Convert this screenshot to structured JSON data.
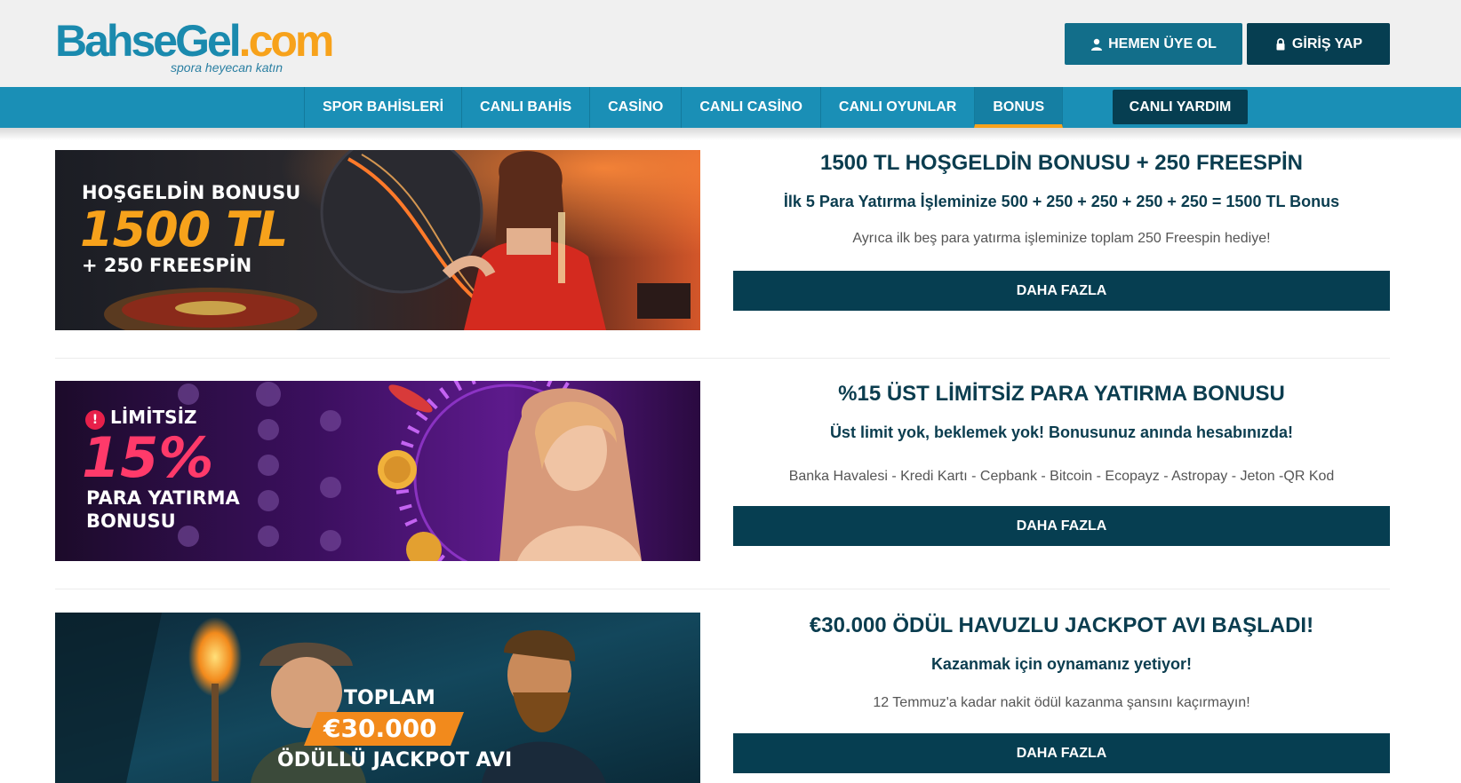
{
  "header": {
    "logo_brand": "BahseGel",
    "logo_tld": ".com",
    "logo_tagline": "spora heyecan katın",
    "register_label": "HEMEN ÜYE OL",
    "login_label": "GİRİŞ YAP"
  },
  "nav": {
    "items": [
      {
        "label": "SPOR BAHİSLERİ"
      },
      {
        "label": "CANLI BAHİS"
      },
      {
        "label": "CASİNO"
      },
      {
        "label": "CANLI CASİNO"
      },
      {
        "label": "CANLI OYUNLAR"
      },
      {
        "label": "BONUS"
      }
    ],
    "active": "BONUS",
    "help_label": "CANLI YARDIM"
  },
  "promos": [
    {
      "banner": {
        "line1": "HOŞGELDİN BONUSU",
        "line2": "1500 TL",
        "line3": "+ 250 FREESPİN"
      },
      "title": "1500 TL HOŞGELDİN BONUSU + 250 FREESPİN",
      "subtitle": "İlk 5 Para Yatırma İşleminize 500 + 250 + 250 + 250 + 250 = 1500 TL Bonus",
      "description": "Ayrıca ilk beş para yatırma işleminize toplam 250 Freespin hediye!",
      "button": "DAHA FAZLA"
    },
    {
      "banner": {
        "line1": "LİMİTSİZ",
        "line2": "15%",
        "line3": "PARA YATIRMA",
        "line4": "BONUSU"
      },
      "title": "%15 ÜST LİMİTSİZ PARA YATIRMA BONUSU",
      "subtitle": "Üst limit yok, beklemek yok! Bonusunuz anında hesabınızda!",
      "description": "Banka Havalesi - Kredi Kartı - Cepbank - Bitcoin - Ecopayz - Astropay - Jeton -QR Kod",
      "button": "DAHA FAZLA"
    },
    {
      "banner": {
        "line1": "TOPLAM",
        "line2": "€30.000",
        "line3": "ÖDÜLLÜ JACKPOT AVI"
      },
      "title": "€30.000 ÖDÜL HAVUZLU JACKPOT AVI BAŞLADI!",
      "subtitle": "Kazanmak için oynamanız yetiyor!",
      "description": "12 Temmuz'a kadar nakit ödül kazanma şansını kaçırmayın!",
      "button": "DAHA FAZLA"
    }
  ],
  "colors": {
    "primary": "#1a8fb6",
    "dark": "#063e51",
    "accent": "#f7a21b"
  }
}
